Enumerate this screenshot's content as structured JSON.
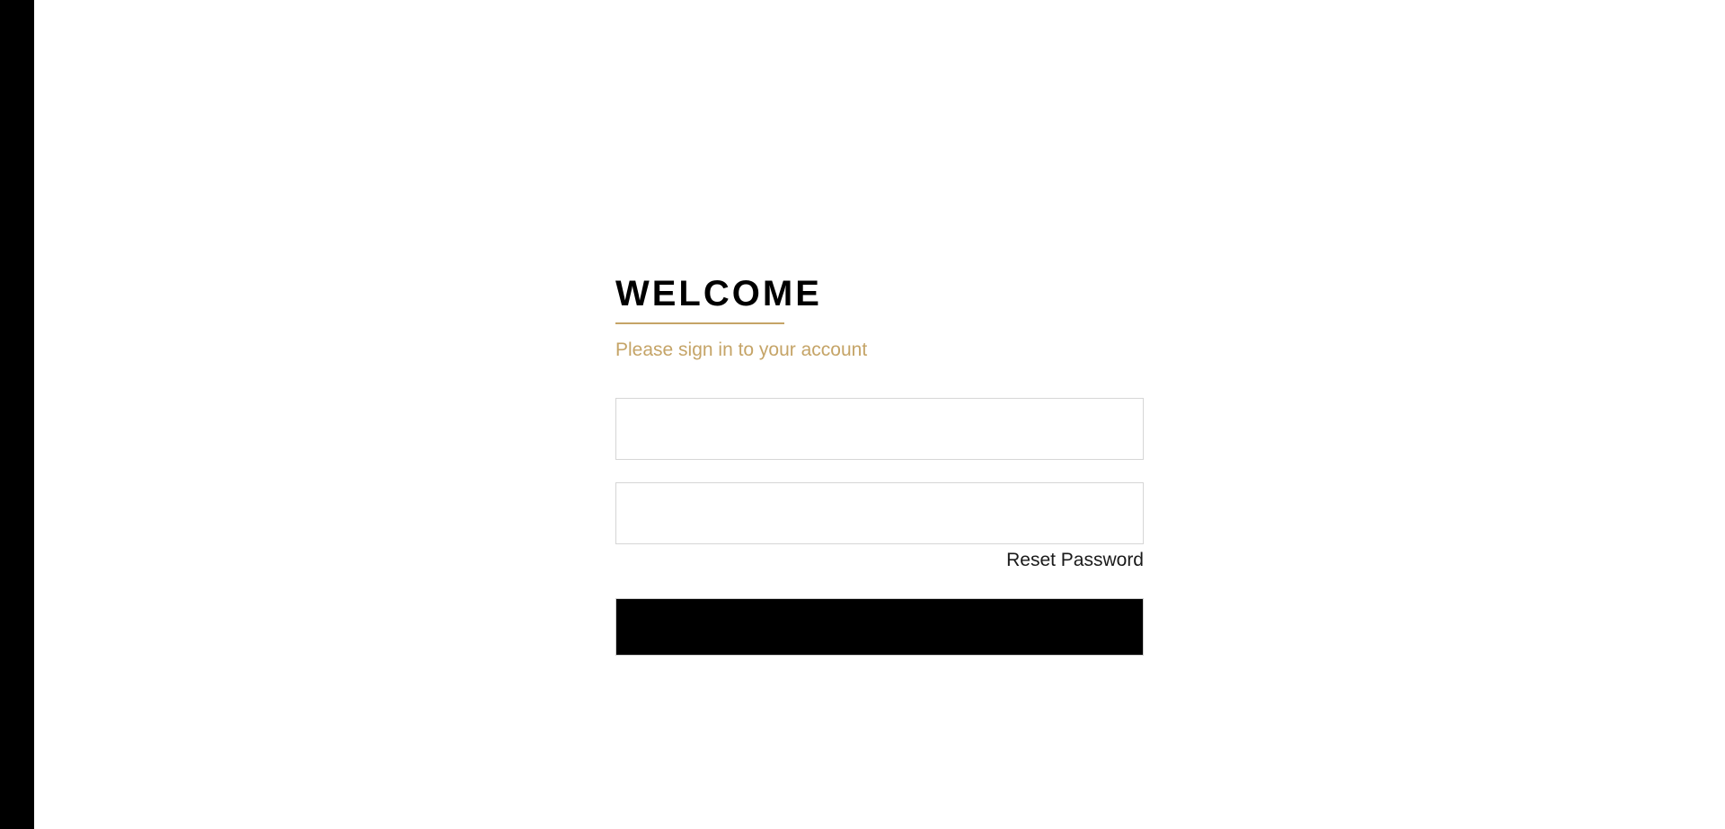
{
  "login": {
    "title": "WELCOME",
    "subtitle": "Please sign in to your account",
    "username": {
      "value": "",
      "placeholder": ""
    },
    "password": {
      "value": "",
      "placeholder": ""
    },
    "reset_label": "Reset Password",
    "submit_label": ""
  },
  "colors": {
    "accent": "#c5a467",
    "sidebar": "#000000",
    "button": "#000000",
    "field_border": "#d6d6d6"
  }
}
